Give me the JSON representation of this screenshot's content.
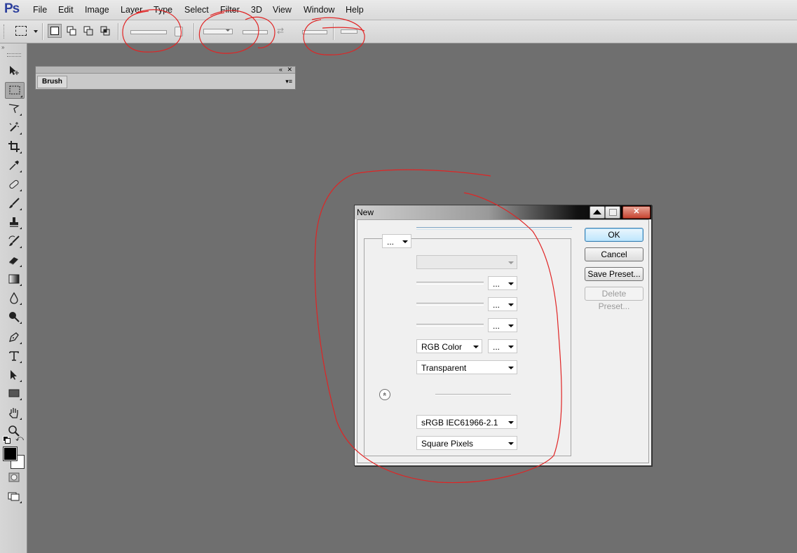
{
  "app": {
    "logo": "Ps"
  },
  "menu": [
    "File",
    "Edit",
    "Image",
    "Layer",
    "Type",
    "Select",
    "Filter",
    "3D",
    "View",
    "Window",
    "Help"
  ],
  "panels": {
    "brush": {
      "tab_label": "Brush"
    }
  },
  "dialog": {
    "title": "New",
    "preset_button_label": "...",
    "unit_buttons": [
      "...",
      "...",
      "...",
      "..."
    ],
    "color_mode": "RGB Color",
    "background_contents": "Transparent",
    "color_profile": "sRGB IEC61966-2.1",
    "pixel_aspect_ratio": "Square Pixels",
    "buttons": {
      "ok": "OK",
      "cancel": "Cancel",
      "save_preset": "Save Preset...",
      "delete_preset": "Delete Preset..."
    },
    "advanced_toggle": "»"
  },
  "colors": {
    "annotation": "#e02424",
    "canvas": "#6f6f6f",
    "logo": "#2c3f9c"
  }
}
